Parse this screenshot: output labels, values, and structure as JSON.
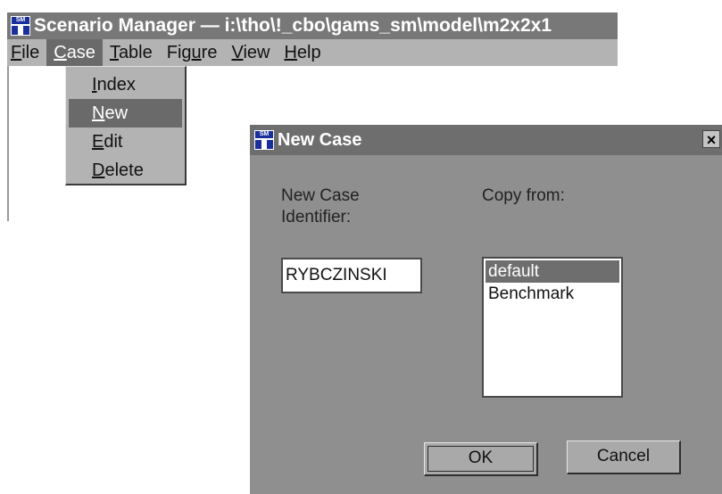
{
  "main_window": {
    "title": "Scenario Manager — i:\\tho\\!_cbo\\gams_sm\\model\\m2x2x1",
    "icon": "scenario-manager-icon",
    "icon_text": "SM"
  },
  "menubar": {
    "items": [
      {
        "accel": "F",
        "rest": "ile"
      },
      {
        "accel": "C",
        "rest": "ase"
      },
      {
        "accel": "T",
        "rest": "able"
      },
      {
        "pre": "Fig",
        "accel": "u",
        "rest": "re"
      },
      {
        "accel": "V",
        "rest": "iew"
      },
      {
        "accel": "H",
        "rest": "elp"
      }
    ],
    "active_index": 1
  },
  "case_menu": {
    "items": [
      {
        "accel": "I",
        "rest": "ndex"
      },
      {
        "accel": "N",
        "rest": "ew"
      },
      {
        "accel": "E",
        "rest": "dit"
      },
      {
        "accel": "D",
        "rest": "elete"
      }
    ],
    "highlighted_index": 1
  },
  "dialog": {
    "title": "New Case",
    "close_label": "×",
    "identifier_label": "New Case Identifier:",
    "identifier_value": "RYBCZINSKI",
    "copy_from_label": "Copy from:",
    "copy_from_options": [
      "default",
      "Benchmark"
    ],
    "copy_from_selected_index": 0,
    "ok_label": "OK",
    "cancel_label": "Cancel"
  },
  "colors": {
    "titlebar": "#787878",
    "menubar": "#b3b3b3",
    "dialog_bg": "#8f8f8f",
    "highlight": "#6a6a6a",
    "icon_blue": "#1a2f9c"
  }
}
